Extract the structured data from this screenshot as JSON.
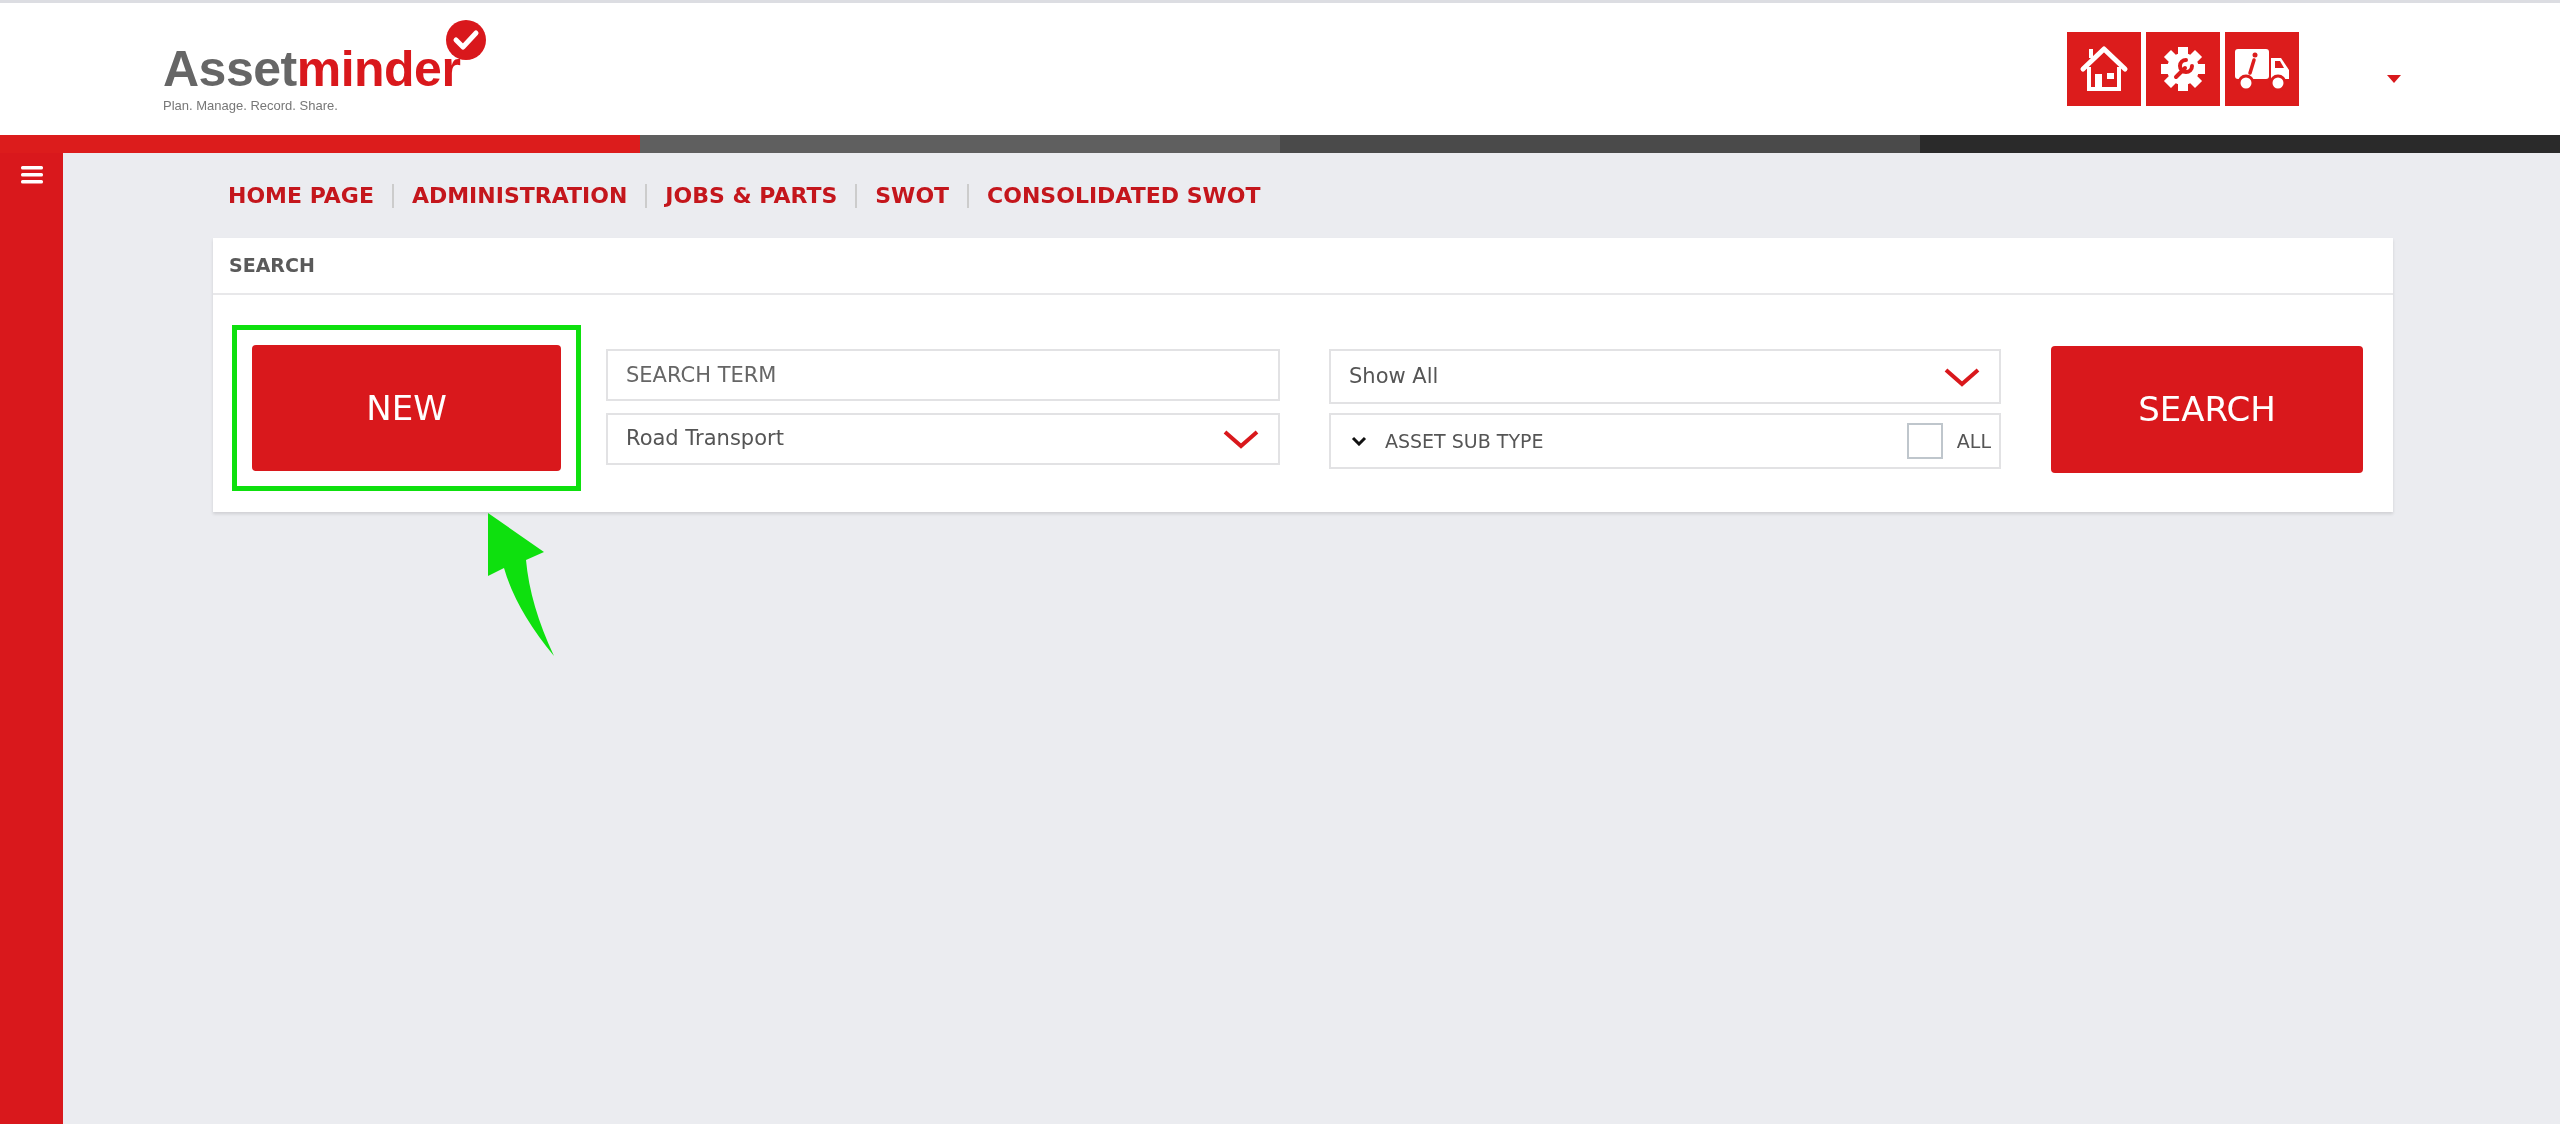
{
  "header": {
    "logo": {
      "words": [
        "Asset",
        "minder"
      ],
      "tagline": "Plan. Manage. Record. Share."
    },
    "toolbar": [
      {
        "kind": "home"
      },
      {
        "kind": "settings"
      },
      {
        "kind": "truck"
      }
    ]
  },
  "nav": [
    "HOME PAGE",
    "ADMINISTRATION",
    "JOBS & PARTS",
    "SWOT",
    "CONSOLIDATED SWOT"
  ],
  "search_panel": {
    "title": "SEARCH",
    "new_button": "NEW",
    "search_term": {
      "placeholder": "SEARCH TERM"
    },
    "asset_type": {
      "value": "Road Transport"
    },
    "filter": {
      "value": "Show All"
    },
    "asset_sub_type": {
      "label": "ASSET SUB TYPE",
      "all_label": "ALL",
      "all_checked": false
    },
    "search_button": "SEARCH"
  }
}
